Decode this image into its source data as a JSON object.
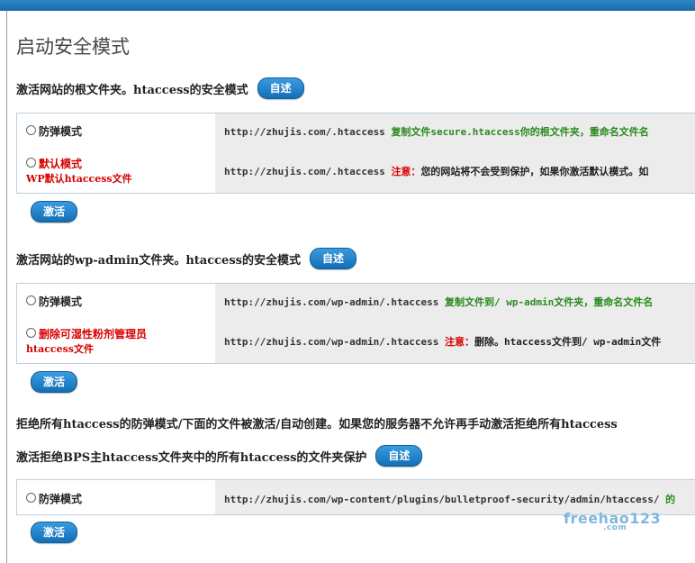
{
  "page_title": "启动安全模式",
  "describe_label": "自述",
  "activate_label": "激活",
  "sections": [
    {
      "heading": "激活网站的根文件夹。htaccess的安全模式",
      "options": [
        {
          "label": "防弹模式",
          "url": "http://zhujis.com/.htaccess",
          "note_prefix": "",
          "note": "复制文件secure.htaccess你的根文件夹，重命名文件名"
        },
        {
          "label": "默认模式",
          "sublabel": "WP默认htaccess文件",
          "url": "http://zhujis.com/.htaccess",
          "note_prefix": "注意：",
          "note": "您的网站将不会受到保护，如果你激活默认模式。如"
        }
      ]
    },
    {
      "heading": "激活网站的wp-admin文件夹。htaccess的安全模式",
      "options": [
        {
          "label": "防弹模式",
          "url": "http://zhujis.com/wp-admin/.htaccess",
          "note_prefix": "",
          "note": "复制文件到/ wp-admin文件夹，重命名文件名"
        },
        {
          "label": "删除可湿性粉剂管理员",
          "sublabel": "htaccess文件",
          "url": "http://zhujis.com/wp-admin/.htaccess",
          "note_prefix": "注意：",
          "note": "删除。htaccess文件到/ wp-admin文件"
        }
      ]
    },
    {
      "pre_text": "拒绝所有htaccess的防弹模式/下面的文件被激活/自动创建。如果您的服务器不允许再手动激活拒绝所有htaccess",
      "heading": "激活拒绝BPS主htaccess文件夹中的所有htaccess的文件夹保护",
      "options": [
        {
          "label": "防弹模式",
          "url": "http://zhujis.com/wp-content/plugins/bulletproof-security/admin/htaccess/",
          "note_prefix": "",
          "note": "的"
        }
      ]
    }
  ],
  "watermark": {
    "text": "freehao123",
    "sub": ".com"
  },
  "colors": {
    "accent": "#1a6aa8",
    "note_green": "#2a8a1f",
    "warn_red": "#d80000",
    "panel_bg": "#ececec"
  }
}
